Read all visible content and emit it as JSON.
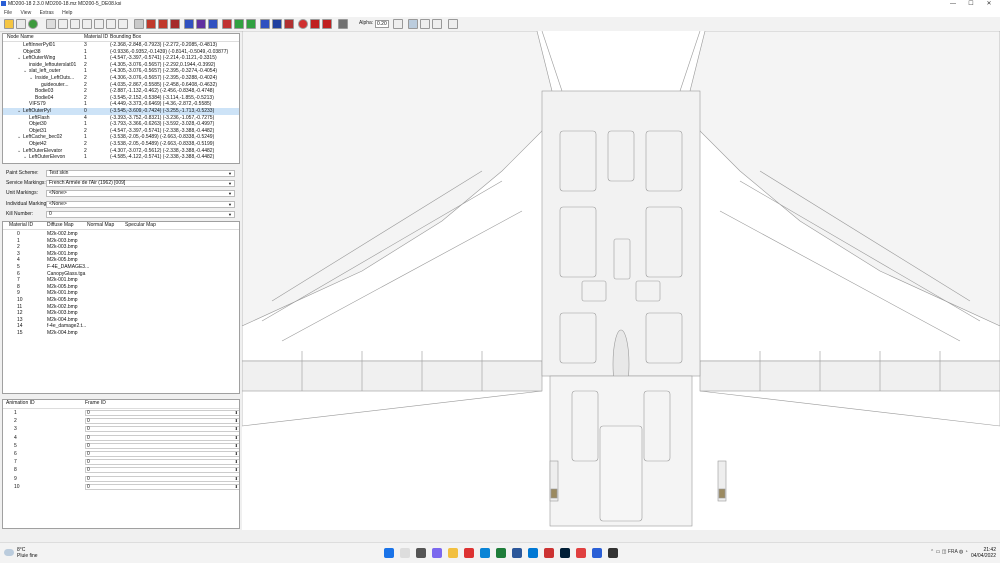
{
  "window": {
    "title": "MD200-18 2.3.0   MD200-18.mz  MD200-5_DE08.ksi",
    "minimize": "—",
    "maximize": "☐",
    "close": "✕"
  },
  "menu": [
    "File",
    "View",
    "Extras",
    "Help"
  ],
  "toolbar": {
    "alpha_label": "Alpha:",
    "alpha_value": "0.20"
  },
  "tree": {
    "headers": {
      "name": "Node Name",
      "material": "Material ID",
      "bbox": "Bounding Box"
    },
    "rows": [
      {
        "name": "LeftInnerPyl01",
        "mat": "3",
        "bbox": "(-2.368,-2.848,-0.7923) (-2.272,-0.2085,-0.4813)",
        "indent": 0,
        "exp": ""
      },
      {
        "name": "Objet38",
        "mat": "1",
        "bbox": "(-0.9336,-0.9352,-0.1439) (-0.8141,-0.5049,-0.03877)",
        "indent": 0,
        "exp": ""
      },
      {
        "name": "LeftOuterWing",
        "mat": "1",
        "bbox": "(-4.547,-3.397,-0.5741) (-2.214,-0.1121,-0.3315)",
        "indent": 0,
        "exp": "⌄"
      },
      {
        "name": "inside_leftouterslat01",
        "mat": "2",
        "bbox": "(-4.305,-3.076,-0.5657) (-2.292,0.1944,-0.3992)",
        "indent": 1,
        "exp": ""
      },
      {
        "name": "slat_left_outer",
        "mat": "1",
        "bbox": "(-4.305,-3.076,-0.5657) (-2.395,-0.3274,-0.4054)",
        "indent": 1,
        "exp": "⌄"
      },
      {
        "name": "Inside_LeftOuts...",
        "mat": "2",
        "bbox": "(-4.306,-3.076,-0.5657) (-2.395,-0.3288,-0.4024)",
        "indent": 2,
        "exp": "⌄"
      },
      {
        "name": "guideouter...",
        "mat": "2",
        "bbox": "(-4.035,-2.867,-0.5585) (-2.458,-0.6408,-0.4632)",
        "indent": 3,
        "exp": ""
      },
      {
        "name": "Bodie03",
        "mat": "2",
        "bbox": "(-2.887,-1.132,-0.462) (-2.456,-0.8348,-0.4748)",
        "indent": 2,
        "exp": ""
      },
      {
        "name": "Bodie04",
        "mat": "2",
        "bbox": "(-3.545,-2.152,-0.5384) (-3.114,-1.855,-0.5213)",
        "indent": 2,
        "exp": ""
      },
      {
        "name": "VIFS79",
        "mat": "1",
        "bbox": "(-4.449,-3.373,-0.6469) (-4.36,-2.872,-0.5585)",
        "indent": 1,
        "exp": ""
      },
      {
        "name": "LeftOuterPyl",
        "mat": "0",
        "bbox": "(-3.545,-3.609,-0.7424) (-3.255,-1.713,-0.5233)",
        "indent": 0,
        "exp": "⌄",
        "sel": true
      },
      {
        "name": "LeftFlash",
        "mat": "4",
        "bbox": "(-3.393,-3.752,-0.8321) (-3.236,-1.057,-0.7275)",
        "indent": 1,
        "exp": ""
      },
      {
        "name": "Objet30",
        "mat": "1",
        "bbox": "(-3.793,-3.366,-0.6263) (-3.592,-3.028,-0.4997)",
        "indent": 1,
        "exp": ""
      },
      {
        "name": "Objet31",
        "mat": "2",
        "bbox": "(-4.547,-3.397,-0.5741) (-2.338,-3.388,-0.4482)",
        "indent": 1,
        "exp": ""
      },
      {
        "name": "LeftCache_bec02",
        "mat": "1",
        "bbox": "(-3.538,-2.05,-0.5489) (-2.663,-0.8338,-0.5249)",
        "indent": 0,
        "exp": "⌄"
      },
      {
        "name": "Objet42",
        "mat": "2",
        "bbox": "(-3.538,-2.05,-0.5489) (-2.663,-0.8338,-0.5199)",
        "indent": 1,
        "exp": ""
      },
      {
        "name": "LeftOuterElevator",
        "mat": "2",
        "bbox": "(-4.307,-3.072,-0.5612) (-2.338,-3.388,-0.4482)",
        "indent": 0,
        "exp": "⌄"
      },
      {
        "name": "LeftOuterElevon",
        "mat": "1",
        "bbox": "(-4.585,-4.122,-0.5741) (-2.338,-3.388,-0.4482)",
        "indent": 1,
        "exp": "⌄"
      }
    ]
  },
  "settings": [
    {
      "label": "Paint Scheme:",
      "value": "Test skin"
    },
    {
      "label": "Service Markings:",
      "value": "French Armée de l'Air (1962) [009]"
    },
    {
      "label": "Unit Markings:",
      "value": "<None>"
    },
    {
      "label": "Individual Markings:",
      "value": "<None>"
    },
    {
      "label": "Kill Number:",
      "value": "0"
    }
  ],
  "materials": {
    "headers": {
      "id": "Material ID",
      "diffuse": "Diffuse Map",
      "normal": "Normal Map",
      "specular": "Specular Map"
    },
    "rows": [
      {
        "id": "0",
        "diffuse": "M2k-002.bmp"
      },
      {
        "id": "1",
        "diffuse": "M2k-003.bmp"
      },
      {
        "id": "2",
        "diffuse": "M2k-003.bmp"
      },
      {
        "id": "3",
        "diffuse": "M2k-001.bmp"
      },
      {
        "id": "4",
        "diffuse": "M2k-005.bmp"
      },
      {
        "id": "5",
        "diffuse": "F-4E_DAMAGE3..."
      },
      {
        "id": "6",
        "diffuse": "CanopyGlass.tga"
      },
      {
        "id": "7",
        "diffuse": "M2k-001.bmp"
      },
      {
        "id": "8",
        "diffuse": "M2k-005.bmp"
      },
      {
        "id": "9",
        "diffuse": "M2k-001.bmp"
      },
      {
        "id": "10",
        "diffuse": "M2k-005.bmp"
      },
      {
        "id": "11",
        "diffuse": "M2k-002.bmp"
      },
      {
        "id": "12",
        "diffuse": "M2k-003.bmp"
      },
      {
        "id": "13",
        "diffuse": "M2k-004.bmp"
      },
      {
        "id": "14",
        "diffuse": "f-4e_damage2.t..."
      },
      {
        "id": "15",
        "diffuse": "M2k-004.bmp"
      }
    ]
  },
  "animation": {
    "headers": {
      "id": "Animation ID",
      "frame": "Frame ID"
    },
    "rows": [
      {
        "id": "1",
        "frame": "0"
      },
      {
        "id": "2",
        "frame": "0"
      },
      {
        "id": "3",
        "frame": "0"
      },
      {
        "id": "4",
        "frame": "0"
      },
      {
        "id": "5",
        "frame": "0"
      },
      {
        "id": "6",
        "frame": "0"
      },
      {
        "id": "7",
        "frame": "0"
      },
      {
        "id": "8",
        "frame": "0"
      },
      {
        "id": "9",
        "frame": "0"
      },
      {
        "id": "10",
        "frame": "0"
      }
    ]
  },
  "taskbar": {
    "weather_temp": "8°C",
    "weather_desc": "Pluie fine",
    "time": "21:42",
    "date": "04/04/2022",
    "lang": "FRA"
  },
  "colors": {
    "accent": "#2a5fd6",
    "selection": "#cde3f7",
    "viewport_bg": "#ffffff"
  }
}
